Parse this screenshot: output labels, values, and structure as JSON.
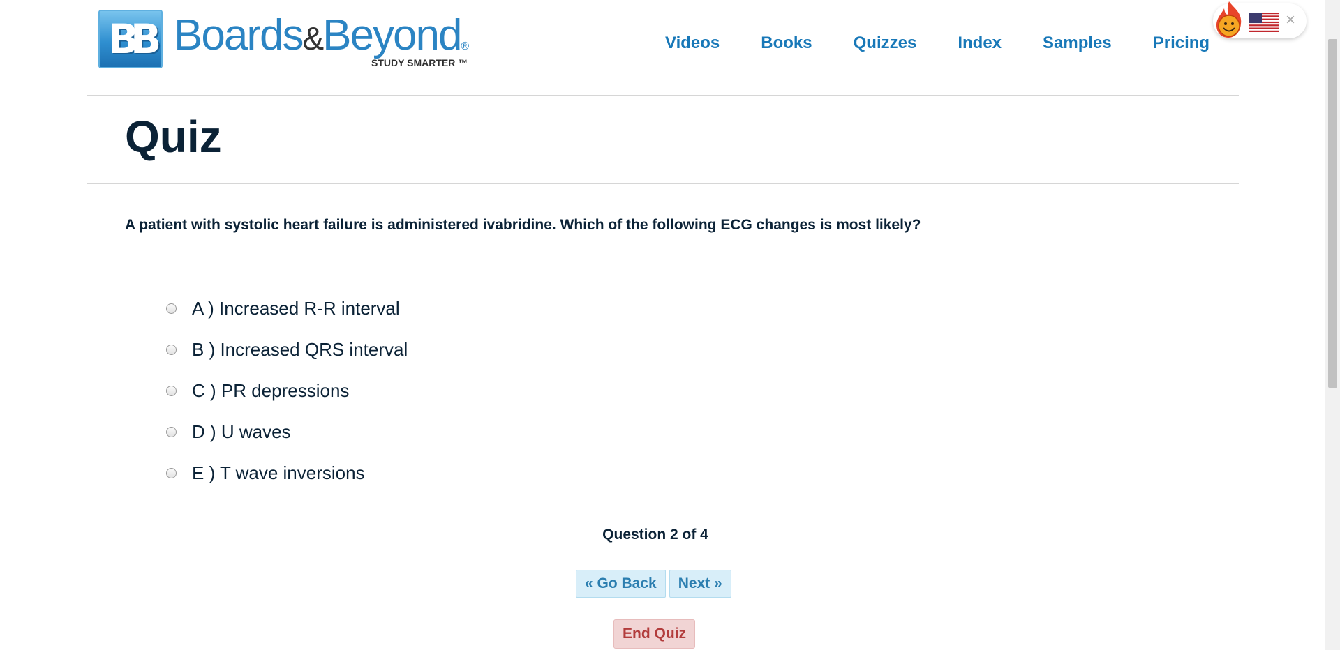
{
  "logo": {
    "badge": "BB",
    "word1": "Boards",
    "amp": "&",
    "word2": "Beyond",
    "registered": "®",
    "tagline": "STUDY SMARTER ™"
  },
  "nav": [
    "Videos",
    "Books",
    "Quizzes",
    "Index",
    "Samples",
    "Pricing"
  ],
  "extension": {
    "flame_icon": "hola-flame-icon",
    "flag_icon": "us-flag-icon",
    "close": "×"
  },
  "page": {
    "title": "Quiz"
  },
  "quiz": {
    "question": "A patient with systolic heart failure is administered ivabridine. Which of the following ECG changes is most likely?",
    "options": [
      "A ) Increased R-R interval",
      "B ) Increased QRS interval",
      "C ) PR depressions",
      "D ) U waves",
      "E ) T wave inversions"
    ],
    "selected": null,
    "progress": "Question 2 of 4",
    "back_label": "« Go Back",
    "next_label": "Next »",
    "end_label": "End Quiz"
  },
  "colors": {
    "nav": "#1878b8",
    "title": "#0b2236",
    "end_bg": "#f1d4d4",
    "end_text": "#b23c3c",
    "nav_btn_bg": "#d8eef9"
  }
}
